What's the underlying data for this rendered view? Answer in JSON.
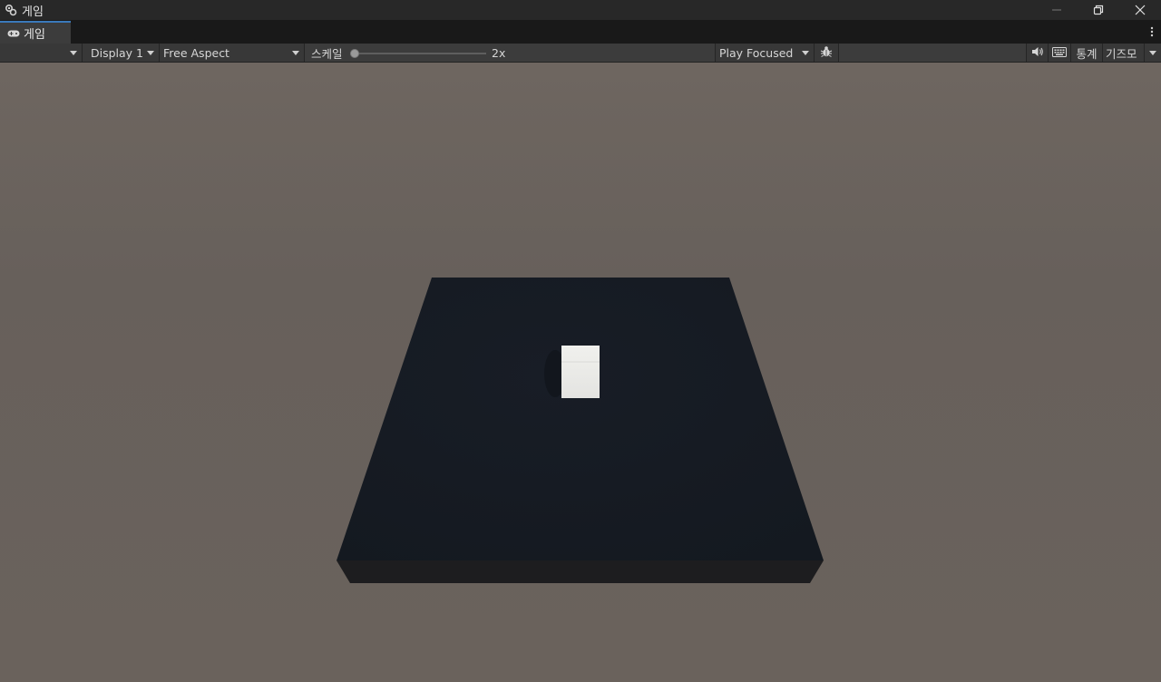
{
  "window": {
    "title": "게임"
  },
  "tabs": [
    {
      "label": "게임",
      "icon": "gamepad-icon",
      "active": true
    }
  ],
  "toolbar": {
    "display": "Display 1",
    "aspect": "Free Aspect",
    "scale_label": "스케일",
    "scale_value": "2x",
    "scale_min_fraction": 0.0,
    "play_mode": "Play Focused",
    "stats_label": "통계",
    "gizmos_label": "기즈모"
  },
  "colors": {
    "accent": "#3a79bb",
    "sky": "#6a625c",
    "platform_top": "#161b23",
    "platform_side": "#1c1c1e",
    "cube": "#e9e9e6"
  }
}
